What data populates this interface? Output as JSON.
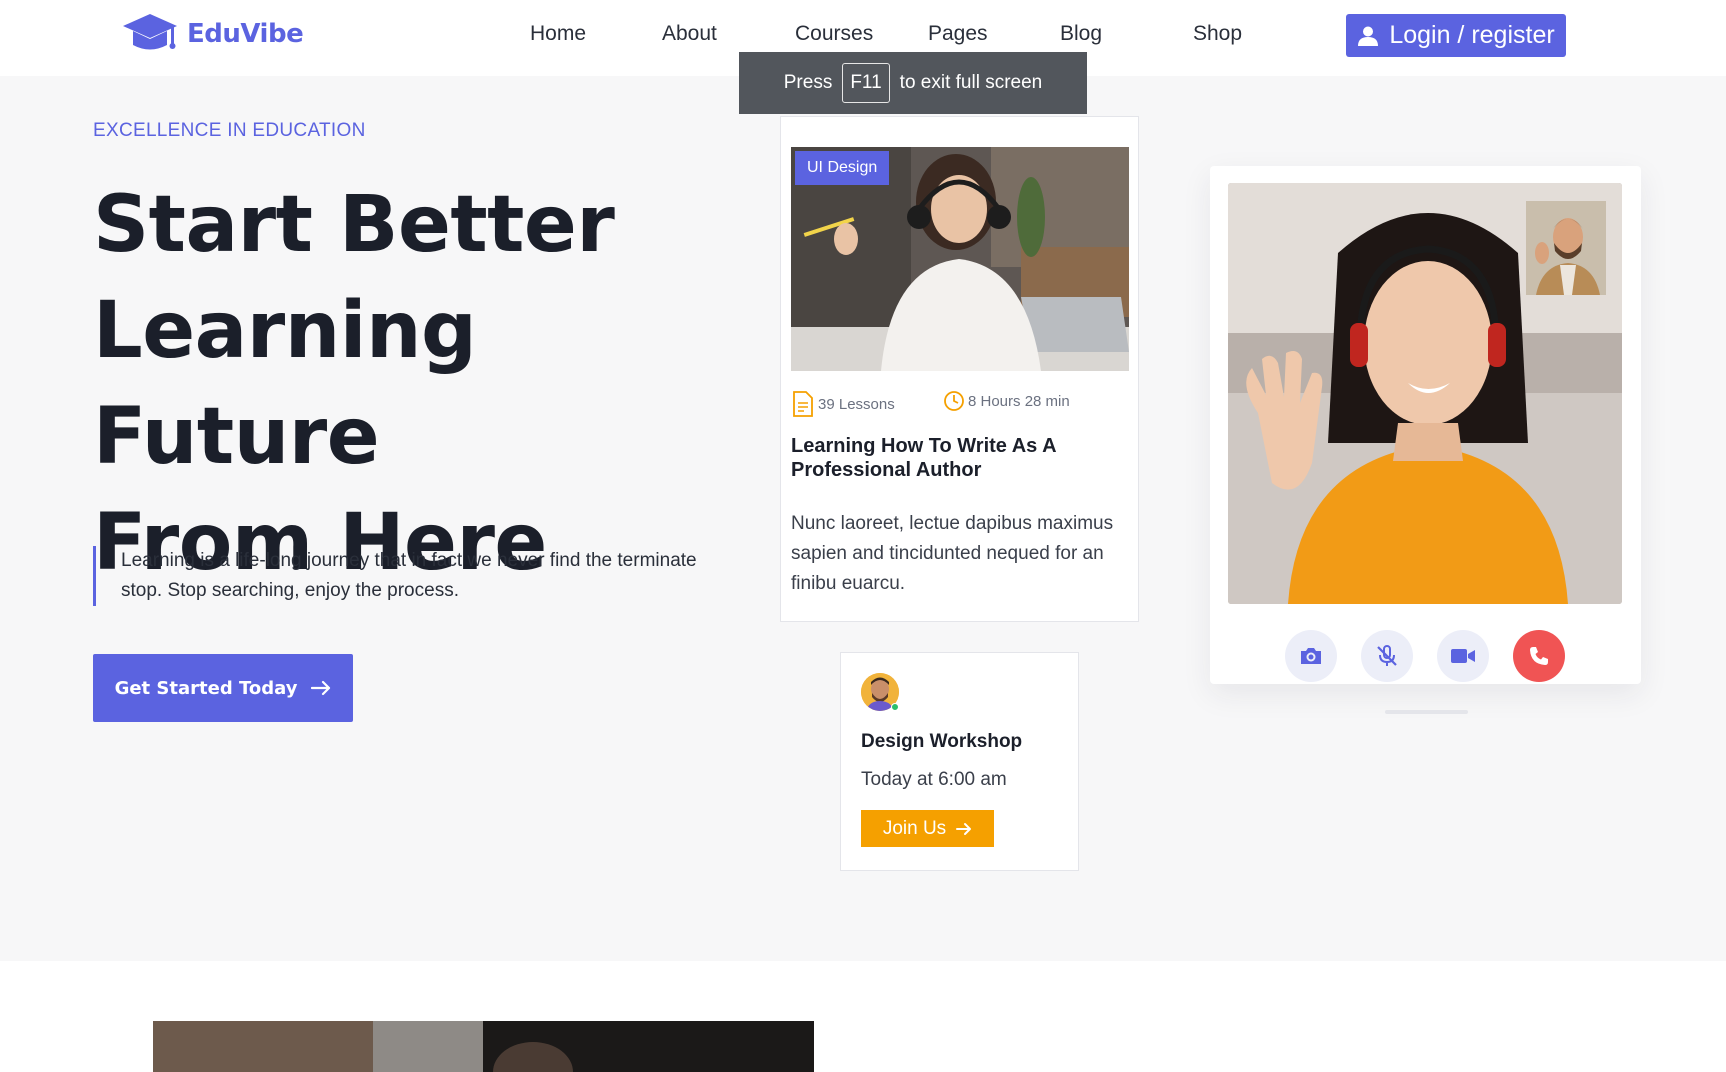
{
  "header": {
    "logo_text": "EduVibe",
    "nav": [
      "Home",
      "About",
      "Courses",
      "Pages",
      "Blog",
      "Shop"
    ],
    "login_label": "Login / register"
  },
  "fullscreen_toast": {
    "prefix": "Press",
    "key": "F11",
    "suffix": "to exit full screen"
  },
  "hero": {
    "eyebrow": "EXCELLENCE IN EDUCATION",
    "headline_lines": [
      "Start Better",
      "Learning Future",
      "From Here"
    ],
    "quote": "Learning is a life-long journey that in fact we never find the terminate stop. Stop searching, enjoy the process.",
    "cta_label": "Get Started Today"
  },
  "course_card": {
    "badge": "UI Design",
    "lessons": "39 Lessons",
    "duration": "8 Hours 28 min",
    "title": "Learning How To Write As A Professional Author",
    "description": "Nunc laoreet, lectue dapibus maximus sapien and tincidunted nequed for an finibu euarcu."
  },
  "workshop_card": {
    "title": "Design Workshop",
    "time": "Today at 6:00 am",
    "button_label": "Join Us"
  },
  "video_call": {
    "controls": [
      "camera-icon",
      "mic-off-icon",
      "video-icon",
      "phone-end-icon"
    ]
  },
  "colors": {
    "accent": "#5b63e0",
    "orange": "#f5a000",
    "danger": "#f05454",
    "hero_bg": "#f7f7f8"
  }
}
